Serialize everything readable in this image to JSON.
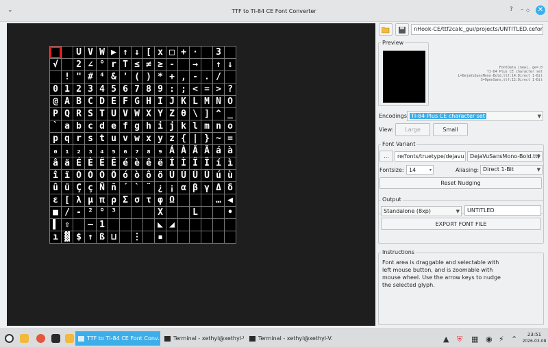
{
  "window": {
    "title": "TTF to TI-84 CE Font Converter",
    "menu_icon": "chevron-down-icon",
    "help_glyph": "?",
    "minimize_glyph": "–",
    "maximize_glyph": "◇",
    "close_glyph": "✕"
  },
  "glyph_rows": [
    [
      "",
      "",
      "U",
      "V",
      "W",
      "▶",
      "↑",
      "↓",
      "[",
      "x",
      "□",
      "+",
      "·",
      "",
      "3",
      ""
    ],
    [
      "√",
      "",
      "2",
      "∠",
      "°",
      "r",
      "T",
      "≤",
      "≠",
      "≥",
      "-",
      "",
      "→",
      "",
      "↑",
      "↓"
    ],
    [
      "",
      "!",
      "\"",
      "#",
      "⁴",
      "&",
      "'",
      "(",
      ")",
      "*",
      "+",
      ",",
      "-",
      ".",
      "/",
      ""
    ],
    [
      "0",
      "1",
      "2",
      "3",
      "4",
      "5",
      "6",
      "7",
      "8",
      "9",
      ":",
      ";",
      "<",
      "=",
      ">",
      "?"
    ],
    [
      "@",
      "A",
      "B",
      "C",
      "D",
      "E",
      "F",
      "G",
      "H",
      "I",
      "J",
      "K",
      "L",
      "M",
      "N",
      "O"
    ],
    [
      "P",
      "Q",
      "R",
      "S",
      "T",
      "U",
      "V",
      "W",
      "X",
      "Y",
      "Z",
      "θ",
      "\\",
      "]",
      "^",
      "_"
    ],
    [
      "`",
      "a",
      "b",
      "c",
      "d",
      "e",
      "f",
      "g",
      "h",
      "i",
      "j",
      "k",
      "l",
      "m",
      "n",
      "o"
    ],
    [
      "p",
      "q",
      "r",
      "s",
      "t",
      "u",
      "v",
      "w",
      "x",
      "y",
      "z",
      "{",
      "|",
      "}",
      "~",
      "="
    ],
    [
      "₀",
      "₁",
      "₂",
      "₃",
      "₄",
      "₅",
      "₆",
      "₇",
      "₈",
      "₉",
      "Á",
      "À",
      "Â",
      "Ä",
      "á",
      "à"
    ],
    [
      "â",
      "ä",
      "É",
      "È",
      "Ê",
      "Ë",
      "é",
      "è",
      "ê",
      "ë",
      "Í",
      "Ì",
      "Î",
      "Ï",
      "í",
      "ì"
    ],
    [
      "î",
      "ï",
      "Ó",
      "Ò",
      "Ô",
      "Ö",
      "ó",
      "ò",
      "ô",
      "ö",
      "Ú",
      "Ù",
      "Û",
      "Ü",
      "ú",
      "ù"
    ],
    [
      "û",
      "ü",
      "Ç",
      "ç",
      "Ñ",
      "ñ",
      "´",
      "`",
      "¨",
      "¿",
      "¡",
      "α",
      "β",
      "γ",
      "Δ",
      "δ"
    ],
    [
      "ε",
      "[",
      "λ",
      "μ",
      "π",
      "ρ",
      "Σ",
      "σ",
      "τ",
      "φ",
      "Ω",
      "",
      "",
      "",
      "…",
      "◀"
    ],
    [
      "■",
      "/",
      "-",
      "²",
      "°",
      "³",
      "",
      "",
      "",
      "X",
      "",
      "",
      "L",
      "",
      "",
      "•"
    ],
    [
      "▌",
      "⇧",
      "",
      "—",
      "1",
      "",
      "",
      "",
      "",
      "◣",
      "◢",
      "",
      "",
      "",
      "",
      ""
    ],
    [
      "ı",
      "▓",
      "$",
      "↑",
      "ß",
      "⊔",
      "",
      "⋮",
      "",
      "▪",
      "",
      "",
      "",
      "",
      "",
      ""
    ]
  ],
  "file_path": "nHook-CE/ttf2calc_gui/projects/UNTITLED.cefont",
  "open_icon": "folder-open-icon",
  "save_icon": "floppy-disk-icon",
  "preview": {
    "label": "Preview",
    "info_lines": [
      "FontData [new], ge=.0",
      "TI-84 Plus CE character set",
      "L=DejaVuSansMono-Bold.ttf:14:Direct 1-Bit",
      "S=OpenSans.ttf:12:Direct 1-Bit"
    ]
  },
  "encodings": {
    "label": "Encodings:",
    "value": "TI-84 Plus CE character set"
  },
  "view": {
    "label": "View:",
    "large": "Large",
    "small": "Small"
  },
  "font_variant": {
    "label": "Font Variant",
    "browse": "...",
    "path": "re/fonts/truetype/dejavu",
    "font": "DejaVuSansMono-Bold.ttf",
    "fontsize_label": "Fontsize:",
    "fontsize": "14",
    "aliasing_label": "Aliasing:",
    "aliasing": "Direct 1-Bit",
    "reset": "Reset Nudging"
  },
  "output": {
    "label": "Output",
    "format": "Standalone (8xp)",
    "name": "UNTITLED",
    "export": "EXPORT FONT FILE"
  },
  "instructions": {
    "label": "Instructions",
    "text": "Font area is draggable and selectable with left mouse button, and is zoomable with mouse wheel. Use the arrow keys to nudge the selected glyph."
  },
  "taskbar": {
    "tasks": [
      {
        "label": "TTF to TI-84 CE Font Conv...",
        "active": true
      },
      {
        "label": "Terminal - xethyl@xethyl-V...",
        "active": false
      },
      {
        "label": "Terminal - xethyl@xethyl-V...",
        "active": false
      }
    ],
    "time": "23:51",
    "date": "2026-03-08"
  },
  "colors": {
    "accent": "#3daee9",
    "canvas": "#1e1e1e",
    "selection": "#e02020"
  }
}
